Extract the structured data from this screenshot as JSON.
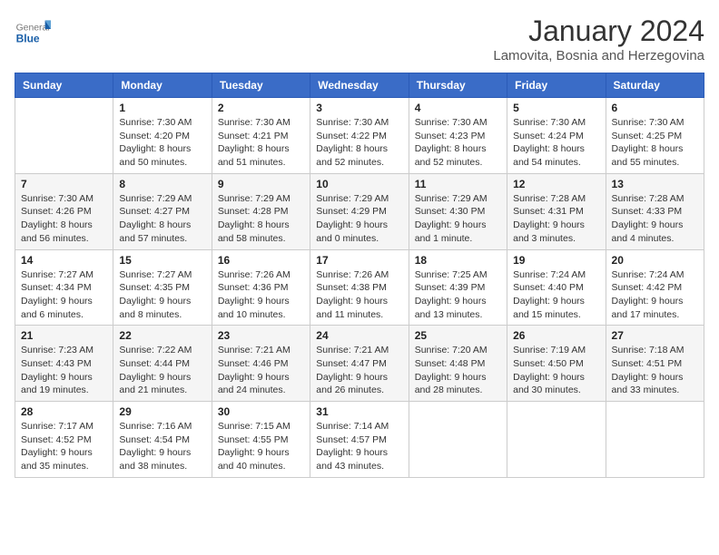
{
  "logo": {
    "general": "General",
    "blue": "Blue"
  },
  "title": "January 2024",
  "location": "Lamovita, Bosnia and Herzegovina",
  "days_of_week": [
    "Sunday",
    "Monday",
    "Tuesday",
    "Wednesday",
    "Thursday",
    "Friday",
    "Saturday"
  ],
  "weeks": [
    [
      {
        "day": "",
        "sunrise": "",
        "sunset": "",
        "daylight": ""
      },
      {
        "day": "1",
        "sunrise": "Sunrise: 7:30 AM",
        "sunset": "Sunset: 4:20 PM",
        "daylight": "Daylight: 8 hours and 50 minutes."
      },
      {
        "day": "2",
        "sunrise": "Sunrise: 7:30 AM",
        "sunset": "Sunset: 4:21 PM",
        "daylight": "Daylight: 8 hours and 51 minutes."
      },
      {
        "day": "3",
        "sunrise": "Sunrise: 7:30 AM",
        "sunset": "Sunset: 4:22 PM",
        "daylight": "Daylight: 8 hours and 52 minutes."
      },
      {
        "day": "4",
        "sunrise": "Sunrise: 7:30 AM",
        "sunset": "Sunset: 4:23 PM",
        "daylight": "Daylight: 8 hours and 52 minutes."
      },
      {
        "day": "5",
        "sunrise": "Sunrise: 7:30 AM",
        "sunset": "Sunset: 4:24 PM",
        "daylight": "Daylight: 8 hours and 54 minutes."
      },
      {
        "day": "6",
        "sunrise": "Sunrise: 7:30 AM",
        "sunset": "Sunset: 4:25 PM",
        "daylight": "Daylight: 8 hours and 55 minutes."
      }
    ],
    [
      {
        "day": "7",
        "sunrise": "Sunrise: 7:30 AM",
        "sunset": "Sunset: 4:26 PM",
        "daylight": "Daylight: 8 hours and 56 minutes."
      },
      {
        "day": "8",
        "sunrise": "Sunrise: 7:29 AM",
        "sunset": "Sunset: 4:27 PM",
        "daylight": "Daylight: 8 hours and 57 minutes."
      },
      {
        "day": "9",
        "sunrise": "Sunrise: 7:29 AM",
        "sunset": "Sunset: 4:28 PM",
        "daylight": "Daylight: 8 hours and 58 minutes."
      },
      {
        "day": "10",
        "sunrise": "Sunrise: 7:29 AM",
        "sunset": "Sunset: 4:29 PM",
        "daylight": "Daylight: 9 hours and 0 minutes."
      },
      {
        "day": "11",
        "sunrise": "Sunrise: 7:29 AM",
        "sunset": "Sunset: 4:30 PM",
        "daylight": "Daylight: 9 hours and 1 minute."
      },
      {
        "day": "12",
        "sunrise": "Sunrise: 7:28 AM",
        "sunset": "Sunset: 4:31 PM",
        "daylight": "Daylight: 9 hours and 3 minutes."
      },
      {
        "day": "13",
        "sunrise": "Sunrise: 7:28 AM",
        "sunset": "Sunset: 4:33 PM",
        "daylight": "Daylight: 9 hours and 4 minutes."
      }
    ],
    [
      {
        "day": "14",
        "sunrise": "Sunrise: 7:27 AM",
        "sunset": "Sunset: 4:34 PM",
        "daylight": "Daylight: 9 hours and 6 minutes."
      },
      {
        "day": "15",
        "sunrise": "Sunrise: 7:27 AM",
        "sunset": "Sunset: 4:35 PM",
        "daylight": "Daylight: 9 hours and 8 minutes."
      },
      {
        "day": "16",
        "sunrise": "Sunrise: 7:26 AM",
        "sunset": "Sunset: 4:36 PM",
        "daylight": "Daylight: 9 hours and 10 minutes."
      },
      {
        "day": "17",
        "sunrise": "Sunrise: 7:26 AM",
        "sunset": "Sunset: 4:38 PM",
        "daylight": "Daylight: 9 hours and 11 minutes."
      },
      {
        "day": "18",
        "sunrise": "Sunrise: 7:25 AM",
        "sunset": "Sunset: 4:39 PM",
        "daylight": "Daylight: 9 hours and 13 minutes."
      },
      {
        "day": "19",
        "sunrise": "Sunrise: 7:24 AM",
        "sunset": "Sunset: 4:40 PM",
        "daylight": "Daylight: 9 hours and 15 minutes."
      },
      {
        "day": "20",
        "sunrise": "Sunrise: 7:24 AM",
        "sunset": "Sunset: 4:42 PM",
        "daylight": "Daylight: 9 hours and 17 minutes."
      }
    ],
    [
      {
        "day": "21",
        "sunrise": "Sunrise: 7:23 AM",
        "sunset": "Sunset: 4:43 PM",
        "daylight": "Daylight: 9 hours and 19 minutes."
      },
      {
        "day": "22",
        "sunrise": "Sunrise: 7:22 AM",
        "sunset": "Sunset: 4:44 PM",
        "daylight": "Daylight: 9 hours and 21 minutes."
      },
      {
        "day": "23",
        "sunrise": "Sunrise: 7:21 AM",
        "sunset": "Sunset: 4:46 PM",
        "daylight": "Daylight: 9 hours and 24 minutes."
      },
      {
        "day": "24",
        "sunrise": "Sunrise: 7:21 AM",
        "sunset": "Sunset: 4:47 PM",
        "daylight": "Daylight: 9 hours and 26 minutes."
      },
      {
        "day": "25",
        "sunrise": "Sunrise: 7:20 AM",
        "sunset": "Sunset: 4:48 PM",
        "daylight": "Daylight: 9 hours and 28 minutes."
      },
      {
        "day": "26",
        "sunrise": "Sunrise: 7:19 AM",
        "sunset": "Sunset: 4:50 PM",
        "daylight": "Daylight: 9 hours and 30 minutes."
      },
      {
        "day": "27",
        "sunrise": "Sunrise: 7:18 AM",
        "sunset": "Sunset: 4:51 PM",
        "daylight": "Daylight: 9 hours and 33 minutes."
      }
    ],
    [
      {
        "day": "28",
        "sunrise": "Sunrise: 7:17 AM",
        "sunset": "Sunset: 4:52 PM",
        "daylight": "Daylight: 9 hours and 35 minutes."
      },
      {
        "day": "29",
        "sunrise": "Sunrise: 7:16 AM",
        "sunset": "Sunset: 4:54 PM",
        "daylight": "Daylight: 9 hours and 38 minutes."
      },
      {
        "day": "30",
        "sunrise": "Sunrise: 7:15 AM",
        "sunset": "Sunset: 4:55 PM",
        "daylight": "Daylight: 9 hours and 40 minutes."
      },
      {
        "day": "31",
        "sunrise": "Sunrise: 7:14 AM",
        "sunset": "Sunset: 4:57 PM",
        "daylight": "Daylight: 9 hours and 43 minutes."
      },
      {
        "day": "",
        "sunrise": "",
        "sunset": "",
        "daylight": ""
      },
      {
        "day": "",
        "sunrise": "",
        "sunset": "",
        "daylight": ""
      },
      {
        "day": "",
        "sunrise": "",
        "sunset": "",
        "daylight": ""
      }
    ]
  ]
}
